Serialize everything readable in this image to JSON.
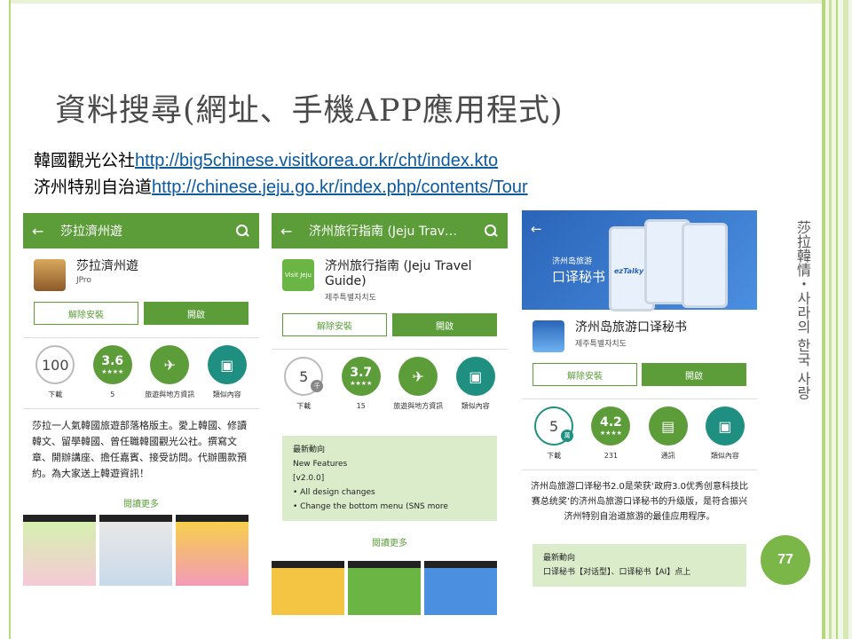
{
  "slide": {
    "title": "資料搜尋(網址、手機APP應用程式)",
    "sources": [
      {
        "label": "韓國觀光公社",
        "url": "http://big5chinese.visitkorea.or.kr/cht/index.kto"
      },
      {
        "label": "济州特别自治道",
        "url": "http://chinese.jeju.go.kr/index.php/contents/Tour"
      }
    ],
    "side_text": "莎拉韓情・사라의 한국 사랑",
    "page_number": "77"
  },
  "apps": [
    {
      "bar_title": "莎拉濟州遊",
      "name": "莎拉濟州遊",
      "developer": "JPro",
      "uninstall_label": "解除安裝",
      "open_label": "開啟",
      "downloads": "100",
      "downloads_label": "下載",
      "rating": "3.6",
      "rating_count": "5",
      "category_label": "旅遊與地方資訊",
      "similar_label": "類似內容",
      "description": "莎拉一人氣韓國旅遊部落格版主。愛上韓國、修讀韓文、留學韓國、曾任職韓國觀光公社。撰寫文章、開辦講座、擔任嘉賓、接受訪問。代辦團款預約。為大家送上韓遊資訊！",
      "more_label": "閱讀更多"
    },
    {
      "bar_title": "济州旅行指南 (Jeju Trav…",
      "name": "济州旅行指南 (Jeju Travel Guide)",
      "developer": "제주특별자치도",
      "uninstall_label": "解除安裝",
      "open_label": "開啟",
      "downloads": "5",
      "downloads_sub": "千",
      "downloads_label": "下載",
      "rating": "3.7",
      "rating_count": "15",
      "category_label": "旅遊與地方資訊",
      "similar_label": "類似內容",
      "new_title": "最新動向",
      "new_lines": [
        "New Features",
        "[v2.0.0]",
        "• All design changes",
        "• Change the bottom menu (SNS more"
      ],
      "more_label": "閱讀更多",
      "icon_text": "Visit Jeju"
    },
    {
      "name": "济州岛旅游口译秘书",
      "developer": "제주특별자치도",
      "banner_title": "济州岛旅游",
      "banner_sub": "口译秘书",
      "banner_logo": "ezTalky",
      "uninstall_label": "解除安裝",
      "open_label": "開啟",
      "downloads": "5",
      "downloads_sub": "萬",
      "downloads_label": "下載",
      "rating": "4.2",
      "rating_count": "231",
      "category_label": "通訊",
      "similar_label": "類似內容",
      "description": "济州岛旅游口译秘书2.0是荣获‘政府3.0优秀创意科技比赛总统奖’的济州岛旅游口译秘书的升级版，是符合振兴济州特别自治道旅游的最佳应用程序。",
      "new_title": "最新動向",
      "new_line": "口译秘书【对话型】、口译秘书【AI】点上"
    }
  ],
  "colors": {
    "brand_green": "#5c9d3a",
    "teal": "#1e8f80",
    "page_circle": "#7ab648",
    "link": "#0b5aa0"
  }
}
